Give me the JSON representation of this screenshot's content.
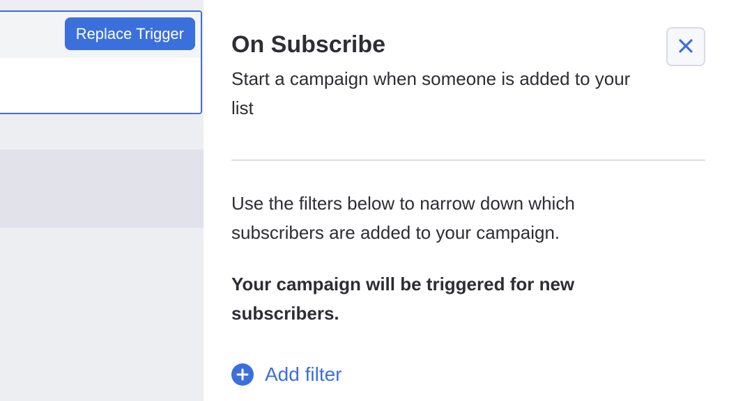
{
  "trigger_card": {
    "replace_label": "Replace Trigger"
  },
  "panel": {
    "title": "On Subscribe",
    "subtitle": "Start a campaign when someone is added to your list",
    "close_icon": "close-icon",
    "filter_description": "Use the filters below to narrow down which subscribers are added to your campaign.",
    "trigger_notice": "Your campaign will be triggered for new subscribers.",
    "add_filter_label": "Add filter",
    "add_filter_icon": "plus-circle-icon"
  },
  "colors": {
    "accent": "#3b6fdc",
    "canvas_bg": "#edeef2",
    "block_bg": "#e1e2ea",
    "text": "#2d2d33",
    "divider": "#dcdde3"
  }
}
